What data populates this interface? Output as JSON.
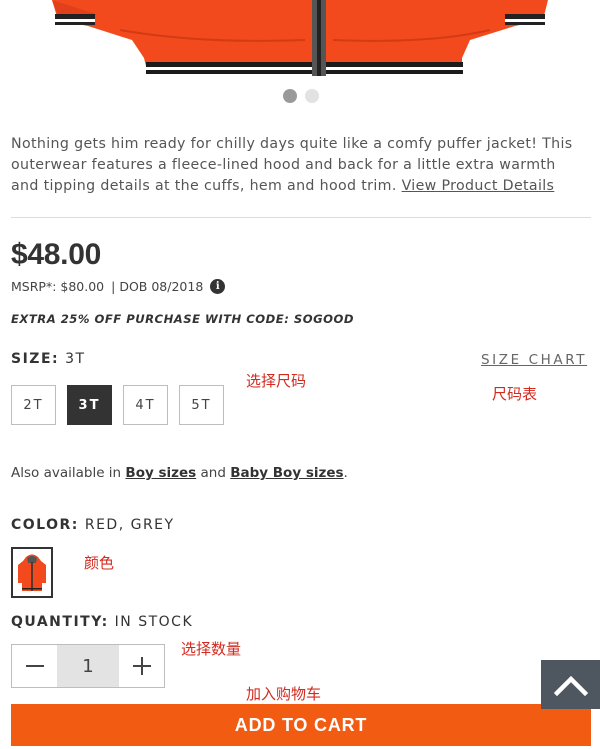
{
  "gallery": {
    "slides": [
      {
        "active": true
      },
      {
        "active": false
      }
    ]
  },
  "description": {
    "text": "Nothing gets him ready for chilly days quite like a comfy puffer jacket! This outerwear features a fleece-lined hood and back for a little extra warmth and tipping details at the cuffs, hem and hood trim.",
    "link": "View Product Details"
  },
  "pricing": {
    "price": "$48.00",
    "msrp": "MSRP*: $80.00",
    "separator": "|",
    "dob": "DOB 08/2018",
    "info_icon_glyph": "i",
    "promo": "EXTRA 25% OFF PURCHASE WITH CODE: SOGOOD"
  },
  "size": {
    "label": "SIZE:",
    "selected": "3T",
    "chart_link": "SIZE CHART",
    "options": [
      "2T",
      "3T",
      "4T",
      "5T"
    ]
  },
  "also": {
    "prefix": "Also available in",
    "link1": "Boy sizes",
    "mid": "and",
    "link2": "Baby Boy sizes",
    "suffix": "."
  },
  "color": {
    "label": "COLOR:",
    "value": "RED, GREY"
  },
  "quantity": {
    "label": "QUANTITY:",
    "status": "IN STOCK",
    "value": "1"
  },
  "cart": {
    "button_label": "ADD TO CART"
  },
  "annotations": {
    "select_size": "选择尺码",
    "size_chart": "尺码表",
    "color": "颜色",
    "select_qty": "选择数量",
    "add_to_cart": "加入购物车"
  },
  "colors": {
    "jacket": "#f34a1d",
    "accent_button": "#f25b12",
    "annotation": "#d32a1f",
    "scroll_top_bg": "#4e5660"
  },
  "icons": {
    "scroll_top": "chevron-up-icon",
    "minus": "minus-icon",
    "plus": "plus-icon",
    "info": "info-icon"
  }
}
